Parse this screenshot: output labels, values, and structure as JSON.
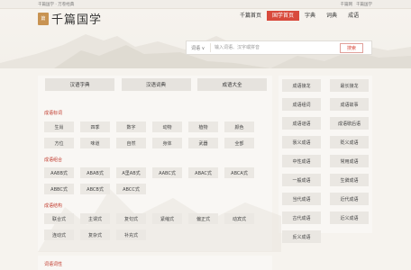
{
  "topbar": {
    "left": "千篇国学 · 万卷经典",
    "right": [
      "千篇网",
      "千篇国学"
    ]
  },
  "logo": {
    "seal": "篇",
    "text": "千篇国学"
  },
  "nav": [
    "千篇首页",
    "国学首页",
    "字典",
    "词典",
    "成语"
  ],
  "search": {
    "type": "词语 ∨",
    "placeholder": "输入词语、汉字或拼音",
    "button": "搜索"
  },
  "tabs": [
    "汉语字典",
    "汉语词典",
    "成语大全"
  ],
  "sections": [
    {
      "title": "成语标词",
      "items": [
        "生肖",
        "四季",
        "数字",
        "动物",
        "植物",
        "颜色",
        "方位",
        "味道",
        "自然",
        "身体",
        "武器",
        "全部"
      ]
    },
    {
      "title": "成语组合",
      "items": [
        "AABB式",
        "ABAB式",
        "A里AB式",
        "AABC式",
        "ABAC式",
        "ABCA式",
        "ABBC式",
        "ABCB式",
        "ABCC式"
      ]
    },
    {
      "title": "成语结构",
      "items": [
        "联合式",
        "主谓式",
        "复句式",
        "紧缩式",
        "偏正式",
        "动宾式",
        "连动式",
        "复杂式",
        "补充式"
      ]
    }
  ],
  "bottom_title": "词语词性",
  "right_links": [
    "成语接龙",
    "最长接龙",
    "成语组词",
    "成语故事",
    "成语谜语",
    "成语歇后语",
    "褒义成语",
    "贬义成语",
    "中性成语",
    "常用成语",
    "一般成语",
    "生僻成语",
    "当代成语",
    "近代成语",
    "古代成语",
    "近义成语",
    "反义成语"
  ]
}
